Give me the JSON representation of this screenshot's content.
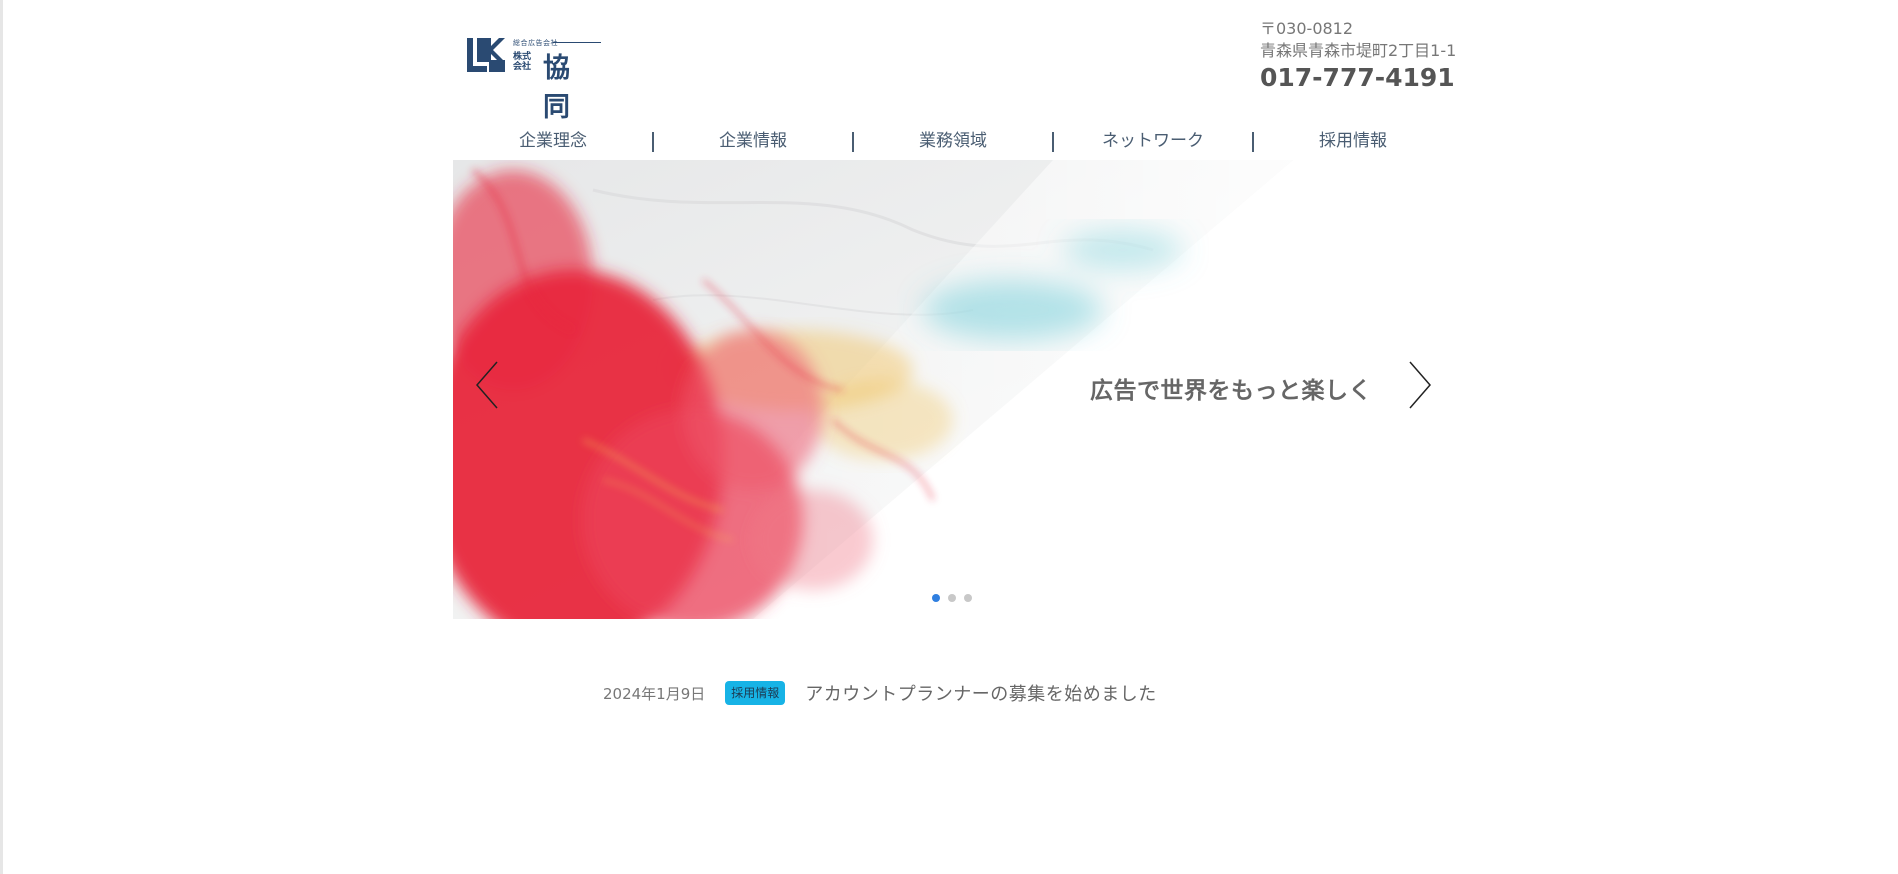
{
  "header": {
    "logo": {
      "small_text": "総合広告会社",
      "kabushiki": "株式会社",
      "name": "協同"
    },
    "contact": {
      "postal": "〒030-0812",
      "address": "青森県青森市堤町2丁目1-1",
      "phone": "017-777-4191"
    }
  },
  "nav": {
    "items": [
      {
        "label": "企業理念"
      },
      {
        "label": "企業情報"
      },
      {
        "label": "業務領域"
      },
      {
        "label": "ネットワーク"
      },
      {
        "label": "採用情報"
      }
    ]
  },
  "slider": {
    "caption": "広告で世界をもっと楽しく",
    "slide_count": 3,
    "active_index": 0,
    "icons": {
      "prev": "chevron-left-icon",
      "next": "chevron-right-icon"
    },
    "colors": {
      "red": "#e8283d",
      "cyan": "#5fc8d4",
      "yellow": "#f2c25a",
      "active_dot": "#2f7fe0"
    }
  },
  "news": {
    "date": "2024年1月9日",
    "tag": "採用情報",
    "title": "アカウントプランナーの募集を始めました",
    "tag_color": "#17b3e6"
  }
}
